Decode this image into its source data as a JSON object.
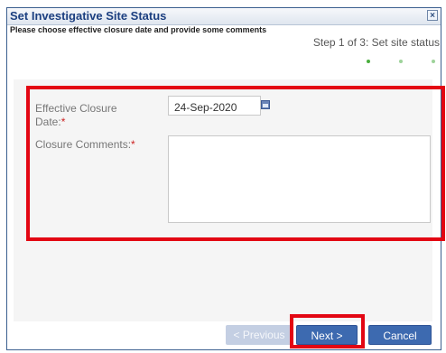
{
  "dialog": {
    "title": "Set Investigative Site Status",
    "close_glyph": "×",
    "instructions": "Please choose effective closure date and provide some comments",
    "step_text": "Step 1 of 3: Set site status",
    "steps_total": 3,
    "current_step": 1
  },
  "form": {
    "closure_date": {
      "label": "Effective Closure Date:",
      "required_marker": "*",
      "value": "24-Sep-2020",
      "icon": "calendar-icon"
    },
    "comments": {
      "label": "Closure Comments:",
      "required_marker": "*",
      "value": ""
    }
  },
  "buttons": {
    "previous": "< Previous",
    "next": "Next >",
    "cancel": "Cancel"
  },
  "colors": {
    "title_text": "#1c3f80",
    "button_blue": "#3d6ab0",
    "button_disabled": "#c4cfe3",
    "highlight": "#e30613",
    "required": "#cc2222",
    "step_dot_active": "#4aae3e",
    "step_dot_inactive": "#9ed39a"
  }
}
